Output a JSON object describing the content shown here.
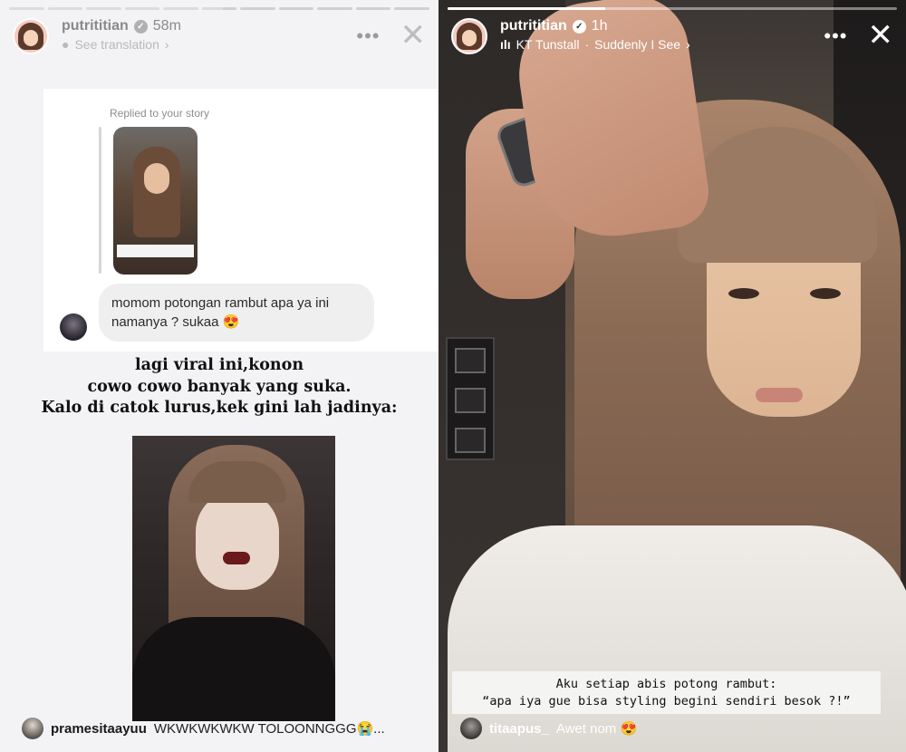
{
  "left_story": {
    "progress": [
      1,
      1,
      1,
      1,
      1,
      0.6,
      0,
      0,
      0,
      0,
      0
    ],
    "header": {
      "username": "putrititian",
      "time": "58m",
      "translation_label": "See translation",
      "more_icon": "more-horizontal-icon",
      "verified_icon": "verified-badge-icon"
    },
    "reply": {
      "replied_label": "Replied to your story",
      "message_line1": "momom potongan rambut apa ya ini",
      "message_line2": "namanya ? sukaa 😍"
    },
    "headline": [
      "lagi viral ini,konon",
      "cowo cowo banyak yang suka.",
      "Kalo di catok lurus,kek gini lah jadinya:"
    ],
    "comment": {
      "username": "pramesitaayuu",
      "text": "WKWKWKWKW TOLOONNGGG😭..."
    }
  },
  "right_story": {
    "progress": [
      0.35
    ],
    "header": {
      "username": "putrititian",
      "time": "1h",
      "music_artist": "KT Tunstall",
      "music_separator": "·",
      "music_song": "Suddenly I See",
      "more_icon": "more-horizontal-icon",
      "close_icon": "close-icon"
    },
    "caption_line1": "Aku setiap abis potong rambut:",
    "caption_line2": "“apa iya gue bisa styling begini sendiri besok ?!”",
    "comment": {
      "username": "titaapus_",
      "text": "Awet nom 😍"
    }
  }
}
